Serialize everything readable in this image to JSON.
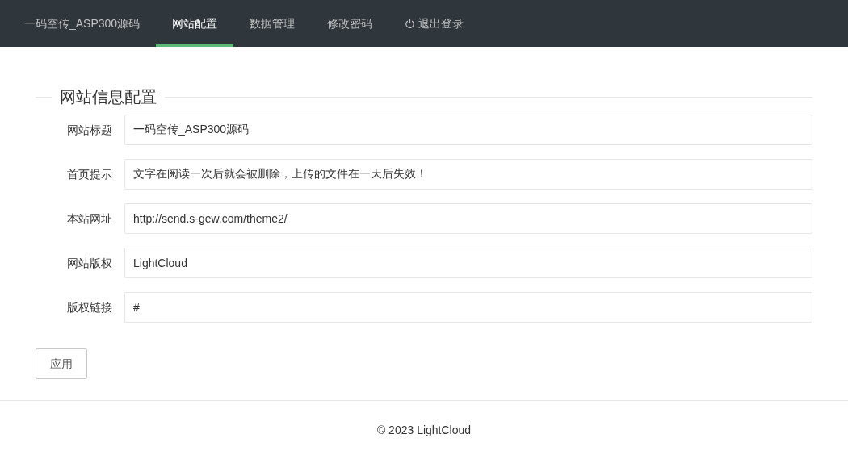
{
  "nav": {
    "items": [
      {
        "kind": "brand",
        "label": "一码空传_ASP300源码",
        "selected": false
      },
      {
        "kind": "tab",
        "label": "网站配置",
        "selected": true
      },
      {
        "kind": "tab",
        "label": "数据管理",
        "selected": false
      },
      {
        "kind": "tab",
        "label": "修改密码",
        "selected": false
      },
      {
        "kind": "logout",
        "label": "退出登录",
        "selected": false
      }
    ]
  },
  "form": {
    "legend": "网站信息配置",
    "fields": [
      {
        "label": "网站标题",
        "value": "一码空传_ASP300源码"
      },
      {
        "label": "首页提示",
        "value": "文字在阅读一次后就会被删除，上传的文件在一天后失效！"
      },
      {
        "label": "本站网址",
        "value": "http://send.s-gew.com/theme2/"
      },
      {
        "label": "网站版权",
        "value": "LightCloud"
      },
      {
        "label": "版权链接",
        "value": "#"
      }
    ],
    "button": "应用"
  },
  "footer": "© 2023 LightCloud"
}
